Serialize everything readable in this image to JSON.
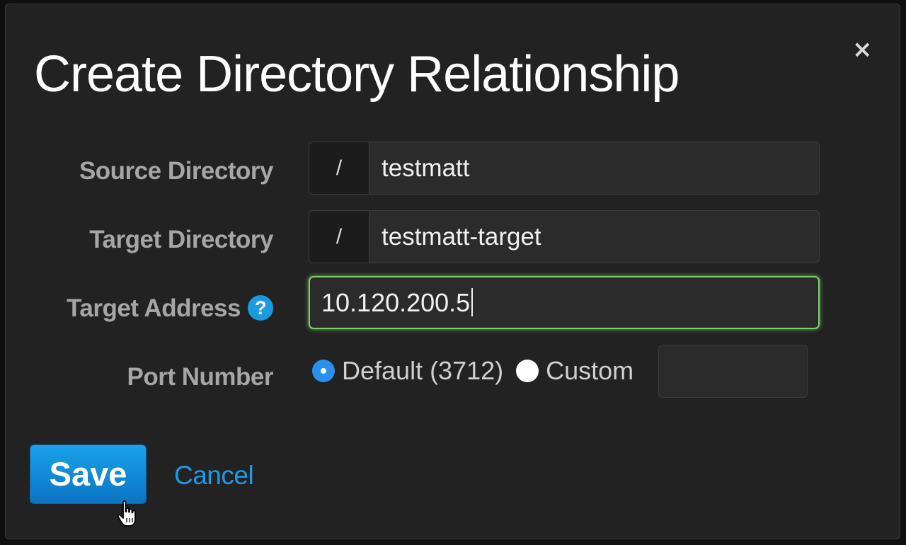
{
  "dialog": {
    "title": "Create Directory Relationship",
    "close_glyph": "×",
    "close_icon": "close-icon"
  },
  "form": {
    "source_directory": {
      "label": "Source Directory",
      "prefix": "/",
      "value": "testmatt"
    },
    "target_directory": {
      "label": "Target Directory",
      "prefix": "/",
      "value": "testmatt-target"
    },
    "target_address": {
      "label": "Target Address",
      "help_glyph": "?",
      "help_icon": "help-icon",
      "value": "10.120.200.5",
      "focused": true
    },
    "port_number": {
      "label": "Port Number",
      "options": [
        {
          "label": "Default (3712)",
          "selected": true
        },
        {
          "label": "Custom",
          "selected": false
        }
      ],
      "custom_value": ""
    }
  },
  "actions": {
    "save_label": "Save",
    "cancel_label": "Cancel"
  },
  "colors": {
    "accent": "#1a9be0",
    "focus_border": "#7ed06a",
    "dialog_bg": "#222222"
  },
  "pointer_icon": "hand-pointer-icon"
}
